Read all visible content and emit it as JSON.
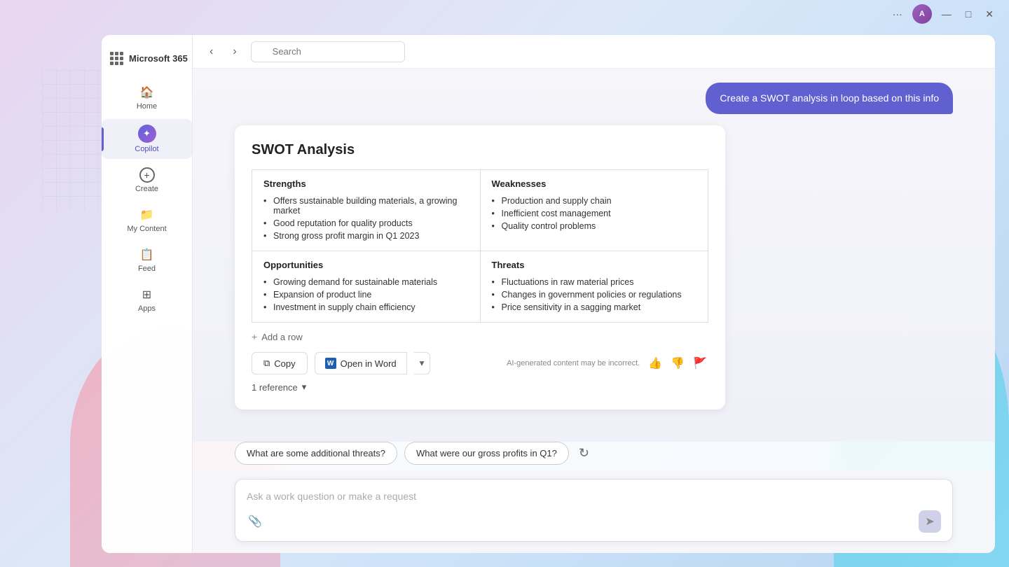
{
  "app": {
    "title": "Microsoft 365"
  },
  "topbar": {
    "more_label": "···",
    "minimize_label": "—",
    "maximize_label": "□",
    "close_label": "✕",
    "avatar_initials": "A"
  },
  "sidebar": {
    "logo_title": "Microsoft 365",
    "items": [
      {
        "id": "home",
        "label": "Home",
        "icon": "🏠"
      },
      {
        "id": "copilot",
        "label": "Copilot",
        "icon": "✦",
        "active": true
      },
      {
        "id": "create",
        "label": "Create",
        "icon": "+"
      },
      {
        "id": "my-content",
        "label": "My Content",
        "icon": "📁"
      },
      {
        "id": "feed",
        "label": "Feed",
        "icon": "📋"
      },
      {
        "id": "apps",
        "label": "Apps",
        "icon": "⊞"
      }
    ]
  },
  "header": {
    "search_placeholder": "Search"
  },
  "user_prompt": {
    "text": "Create a SWOT analysis in loop based on this info"
  },
  "swot": {
    "title": "SWOT Analysis",
    "sections": {
      "strengths_header": "Strengths",
      "strengths_items": [
        "Offers sustainable building materials, a growing market",
        "Good reputation for quality products",
        "Strong gross profit margin in Q1 2023"
      ],
      "weaknesses_header": "Weaknesses",
      "weaknesses_items": [
        "Production and supply chain",
        "Inefficient cost management",
        "Quality control problems"
      ],
      "opportunities_header": "Opportunities",
      "opportunities_items": [
        "Growing demand for sustainable materials",
        "Expansion of product line",
        "Investment in supply chain efficiency"
      ],
      "threats_header": "Threats",
      "threats_items": [
        "Fluctuations in raw material prices",
        "Changes in government policies or regulations",
        "Price sensitivity in a sagging market"
      ]
    },
    "add_row_label": "Add a row",
    "copy_label": "Copy",
    "open_word_label": "Open in Word",
    "ai_disclaimer": "AI-generated content may be incorrect.",
    "reference_label": "1 reference"
  },
  "suggestions": [
    "What are some additional threats?",
    "What were our gross profits in Q1?"
  ],
  "input": {
    "placeholder": "Ask a work question or make a request"
  }
}
